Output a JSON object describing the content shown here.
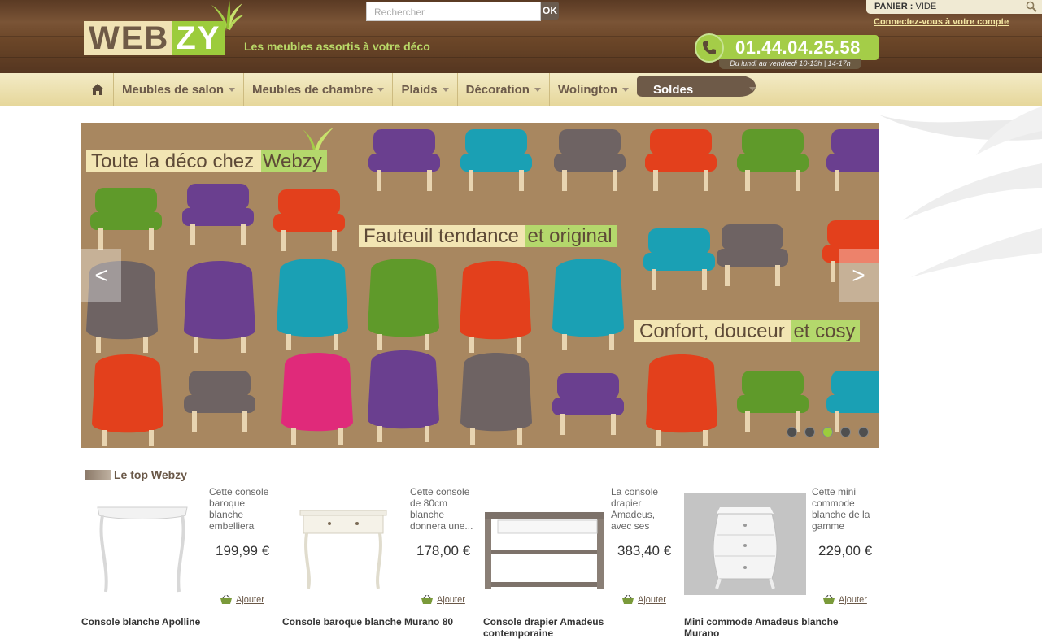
{
  "header": {
    "logo_web": "WEB",
    "logo_zy": "ZY",
    "tagline": "Les meubles assortis à votre déco",
    "search_placeholder": "Rechercher",
    "search_button": "OK",
    "cart_label": "PANIER :",
    "cart_value": "VIDE",
    "account_link": "Connectez-vous à votre compte",
    "phone": "01.44.04.25.58",
    "hours": "Du lundi au vendredi 10-13h | 14-17h"
  },
  "nav": {
    "items": [
      {
        "label": "Meubles de salon"
      },
      {
        "label": "Meubles de chambre"
      },
      {
        "label": "Plaids"
      },
      {
        "label": "Décoration"
      },
      {
        "label": "Wolington"
      }
    ],
    "soldes": "Soldes"
  },
  "slider": {
    "caption1_a": "Toute la déco chez ",
    "caption1_b": "Webzy",
    "caption2_a": "Fauteuil tendance ",
    "caption2_b": "et original",
    "caption3_a": "Confort, douceur ",
    "caption3_b": "et cosy",
    "prev": "<",
    "next": ">",
    "colors": {
      "background": "#a88760",
      "purple": "#6a3f8f",
      "teal": "#1aa0b4",
      "grey": "#6e6363",
      "red": "#e3401c",
      "green": "#5f9a2a",
      "pink": "#e02a7a"
    }
  },
  "products_section": {
    "title": "Le top Webzy",
    "items": [
      {
        "desc": "Cette console baroque blanche embelliera",
        "price": "199,99 €",
        "add": "Ajouter",
        "name": "Console blanche Apolline"
      },
      {
        "desc": "Cette console de 80cm blanche donnera une...",
        "price": "178,00 €",
        "add": "Ajouter",
        "name": "Console baroque blanche Murano 80"
      },
      {
        "desc": "La console drapier Amadeus, avec ses",
        "price": "383,40 €",
        "add": "Ajouter",
        "name": "Console drapier Amadeus contemporaine"
      },
      {
        "desc": "Cette mini commode blanche de la gamme",
        "price": "229,00 €",
        "add": "Ajouter",
        "name": "Mini commode Amadeus blanche Murano"
      }
    ]
  }
}
